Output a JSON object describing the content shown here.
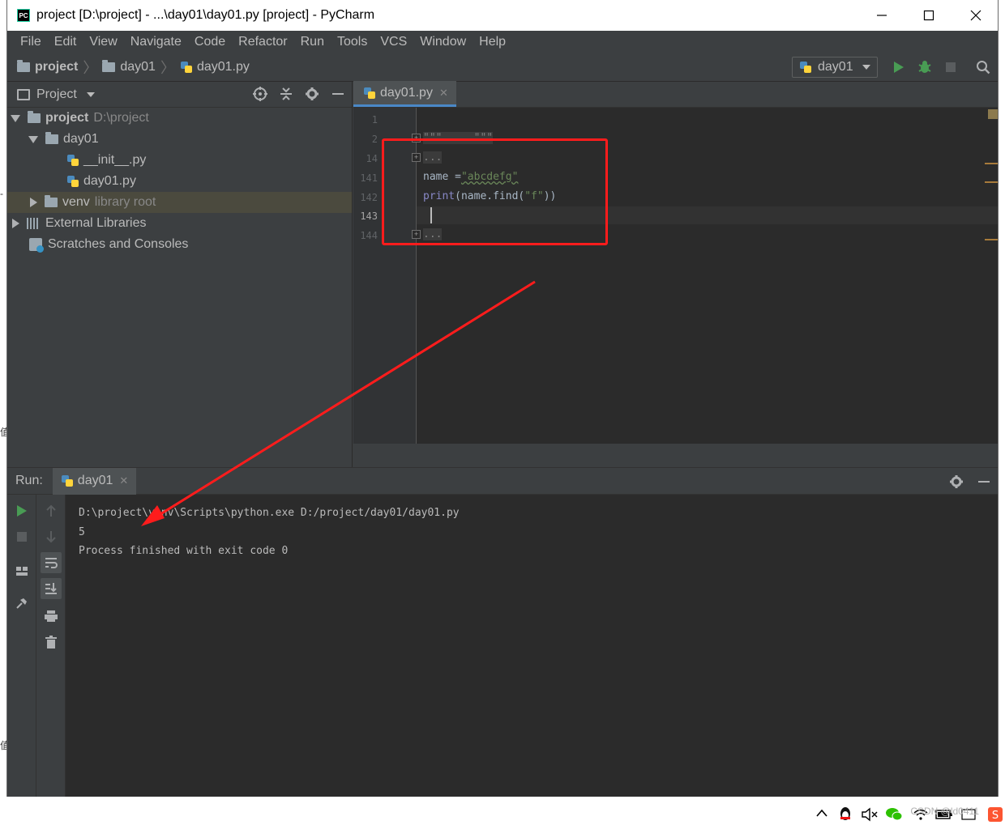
{
  "window": {
    "title": "project [D:\\project] - ...\\day01\\day01.py [project] - PyCharm",
    "app_icon_text": "PC"
  },
  "menu": [
    "File",
    "Edit",
    "View",
    "Navigate",
    "Code",
    "Refactor",
    "Run",
    "Tools",
    "VCS",
    "Window",
    "Help"
  ],
  "breadcrumb": [
    "project",
    "day01",
    "day01.py"
  ],
  "run_config": {
    "name": "day01"
  },
  "project_panel": {
    "title": "Project",
    "tree": {
      "root_name": "project",
      "root_path": "D:\\project",
      "folder": "day01",
      "file1": "__init__.py",
      "file2": "day01.py",
      "venv": "venv",
      "venv_hint": "library root",
      "external_libs": "External Libraries",
      "scratches": "Scratches and Consoles"
    }
  },
  "editor": {
    "tab": "day01.py",
    "line_numbers": [
      "1",
      "2",
      "14",
      "141",
      "142",
      "143",
      "144"
    ],
    "current_line": "143",
    "lines": {
      "l2": "\"\"\" ... \"\"\"",
      "l14": "...",
      "l141_a": "name =",
      "l141_str": "\"abcdefg\"",
      "l142_fn": "print",
      "l142_a": "(name.find(",
      "l142_str": "\"f\"",
      "l142_b": "))",
      "l144": "..."
    }
  },
  "run_panel": {
    "label": "Run:",
    "tab": "day01",
    "output": [
      "D:\\project\\venv\\Scripts\\python.exe D:/project/day01/day01.py",
      "5",
      "",
      "Process finished with exit code 0"
    ]
  },
  "tray": {
    "watermark": "CSDN @ld0411"
  },
  "colors": {
    "annotation_red": "#ff1c1c",
    "run_green": "#499c54",
    "ide_bg": "#3c3f41",
    "editor_bg": "#2b2b2b"
  }
}
